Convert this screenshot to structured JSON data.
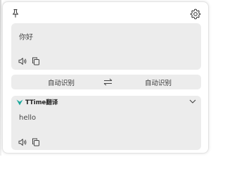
{
  "window": {
    "source": {
      "text": "你好",
      "actions": {
        "speak_icon": "speaker-icon",
        "copy_icon": "copy-icon"
      }
    },
    "language_bar": {
      "source_language": "自动识别",
      "target_language": "自动识别",
      "swap_icon": "swap-icon"
    },
    "result": {
      "engine_name": "TTime翻译",
      "engine_icon_color": "#1aa89c",
      "text": "hello",
      "actions": {
        "speak_icon": "speaker-icon",
        "copy_icon": "copy-icon"
      }
    },
    "toolbar": {
      "pin_icon": "pin-icon",
      "settings_icon": "gear-icon"
    }
  },
  "colors": {
    "panel_background": "#ececec",
    "window_background": "#ffffff",
    "text": "#333333"
  }
}
